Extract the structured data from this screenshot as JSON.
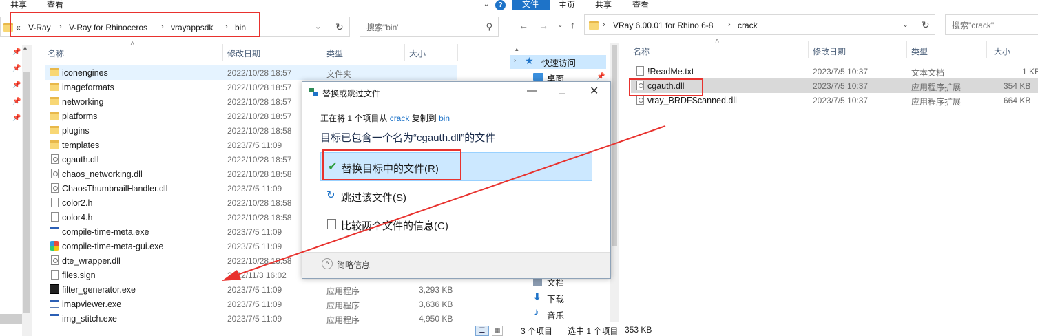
{
  "left": {
    "ribbon": {
      "share": "共享",
      "view": "查看"
    },
    "address": {
      "overflow": "«",
      "crumbs": [
        "V-Ray",
        "V-Ray for Rhinoceros",
        "vrayappsdk",
        "bin"
      ]
    },
    "search": {
      "placeholder": "搜索\"bin\""
    },
    "columns": {
      "name": "名称",
      "date": "修改日期",
      "type": "类型",
      "size": "大小"
    },
    "files": [
      {
        "name": "iconengines",
        "date": "2022/10/28 18:57",
        "type": "文件夹",
        "size": "",
        "icon": "folder"
      },
      {
        "name": "imageformats",
        "date": "2022/10/28 18:57",
        "type": "",
        "size": "",
        "icon": "folder"
      },
      {
        "name": "networking",
        "date": "2022/10/28 18:57",
        "type": "",
        "size": "",
        "icon": "folder"
      },
      {
        "name": "platforms",
        "date": "2022/10/28 18:57",
        "type": "",
        "size": "",
        "icon": "folder"
      },
      {
        "name": "plugins",
        "date": "2022/10/28 18:58",
        "type": "",
        "size": "",
        "icon": "folder"
      },
      {
        "name": "templates",
        "date": "2023/7/5 11:09",
        "type": "",
        "size": "",
        "icon": "folder"
      },
      {
        "name": "cgauth.dll",
        "date": "2022/10/28 18:57",
        "type": "",
        "size": "",
        "icon": "dll"
      },
      {
        "name": "chaos_networking.dll",
        "date": "2022/10/28 18:58",
        "type": "",
        "size": "",
        "icon": "dll"
      },
      {
        "name": "ChaosThumbnailHandler.dll",
        "date": "2023/7/5 11:09",
        "type": "",
        "size": "",
        "icon": "dll"
      },
      {
        "name": "color2.h",
        "date": "2022/10/28 18:58",
        "type": "",
        "size": "",
        "icon": "file"
      },
      {
        "name": "color4.h",
        "date": "2022/10/28 18:58",
        "type": "",
        "size": "",
        "icon": "file"
      },
      {
        "name": "compile-time-meta.exe",
        "date": "2023/7/5 11:09",
        "type": "",
        "size": "",
        "icon": "exe"
      },
      {
        "name": "compile-time-meta-gui.exe",
        "date": "2023/7/5 11:09",
        "type": "",
        "size": "",
        "icon": "gui"
      },
      {
        "name": "dte_wrapper.dll",
        "date": "2022/10/28 18:58",
        "type": "",
        "size": "",
        "icon": "dll"
      },
      {
        "name": "files.sign",
        "date": "2022/11/3 16:02",
        "type": "",
        "size": "",
        "icon": "file"
      },
      {
        "name": "filter_generator.exe",
        "date": "2023/7/5 11:09",
        "type": "应用程序",
        "size": "3,293 KB",
        "icon": "filter"
      },
      {
        "name": "imapviewer.exe",
        "date": "2023/7/5 11:09",
        "type": "应用程序",
        "size": "3,636 KB",
        "icon": "exe"
      },
      {
        "name": "img_stitch.exe",
        "date": "2023/7/5 11:09",
        "type": "应用程序",
        "size": "4,950 KB",
        "icon": "exe"
      }
    ]
  },
  "right": {
    "ribbon": {
      "file": "文件",
      "home": "主页",
      "share": "共享",
      "view": "查看"
    },
    "address": {
      "crumbs": [
        "VRay 6.00.01 for Rhino 6-8",
        "crack"
      ]
    },
    "search": {
      "placeholder": "搜索\"crack\""
    },
    "nav": {
      "quick_access": "快速访问",
      "desktop": "桌面",
      "documents": "文档",
      "downloads": "下载",
      "music": "音乐"
    },
    "columns": {
      "name": "名称",
      "date": "修改日期",
      "type": "类型",
      "size": "大小"
    },
    "files": [
      {
        "name": "!ReadMe.txt",
        "date": "2023/7/5 10:37",
        "type": "文本文档",
        "size": "1 KB",
        "icon": "file"
      },
      {
        "name": "cgauth.dll",
        "date": "2023/7/5 10:37",
        "type": "应用程序扩展",
        "size": "354 KB",
        "icon": "dll"
      },
      {
        "name": "vray_BRDFScanned.dll",
        "date": "2023/7/5 10:37",
        "type": "应用程序扩展",
        "size": "664 KB",
        "icon": "dll"
      }
    ],
    "status": {
      "count": "3 个项目",
      "selected": "选中 1 个项目",
      "size": "353 KB"
    }
  },
  "dialog": {
    "title": "替换或跳过文件",
    "copy_prefix": "正在将 1 个项目从",
    "source": "crack",
    "copy_middle": "复制到",
    "dest": "bin",
    "message": "目标已包含一个名为“cgauth.dll”的文件",
    "replace": "替换目标中的文件(R)",
    "skip": "跳过该文件(S)",
    "compare": "比较两个文件的信息(C)",
    "less_info": "简略信息"
  },
  "colors": {
    "accent": "#1e73c8",
    "highlight": "#cce8ff",
    "annotation": "#e8322e"
  }
}
